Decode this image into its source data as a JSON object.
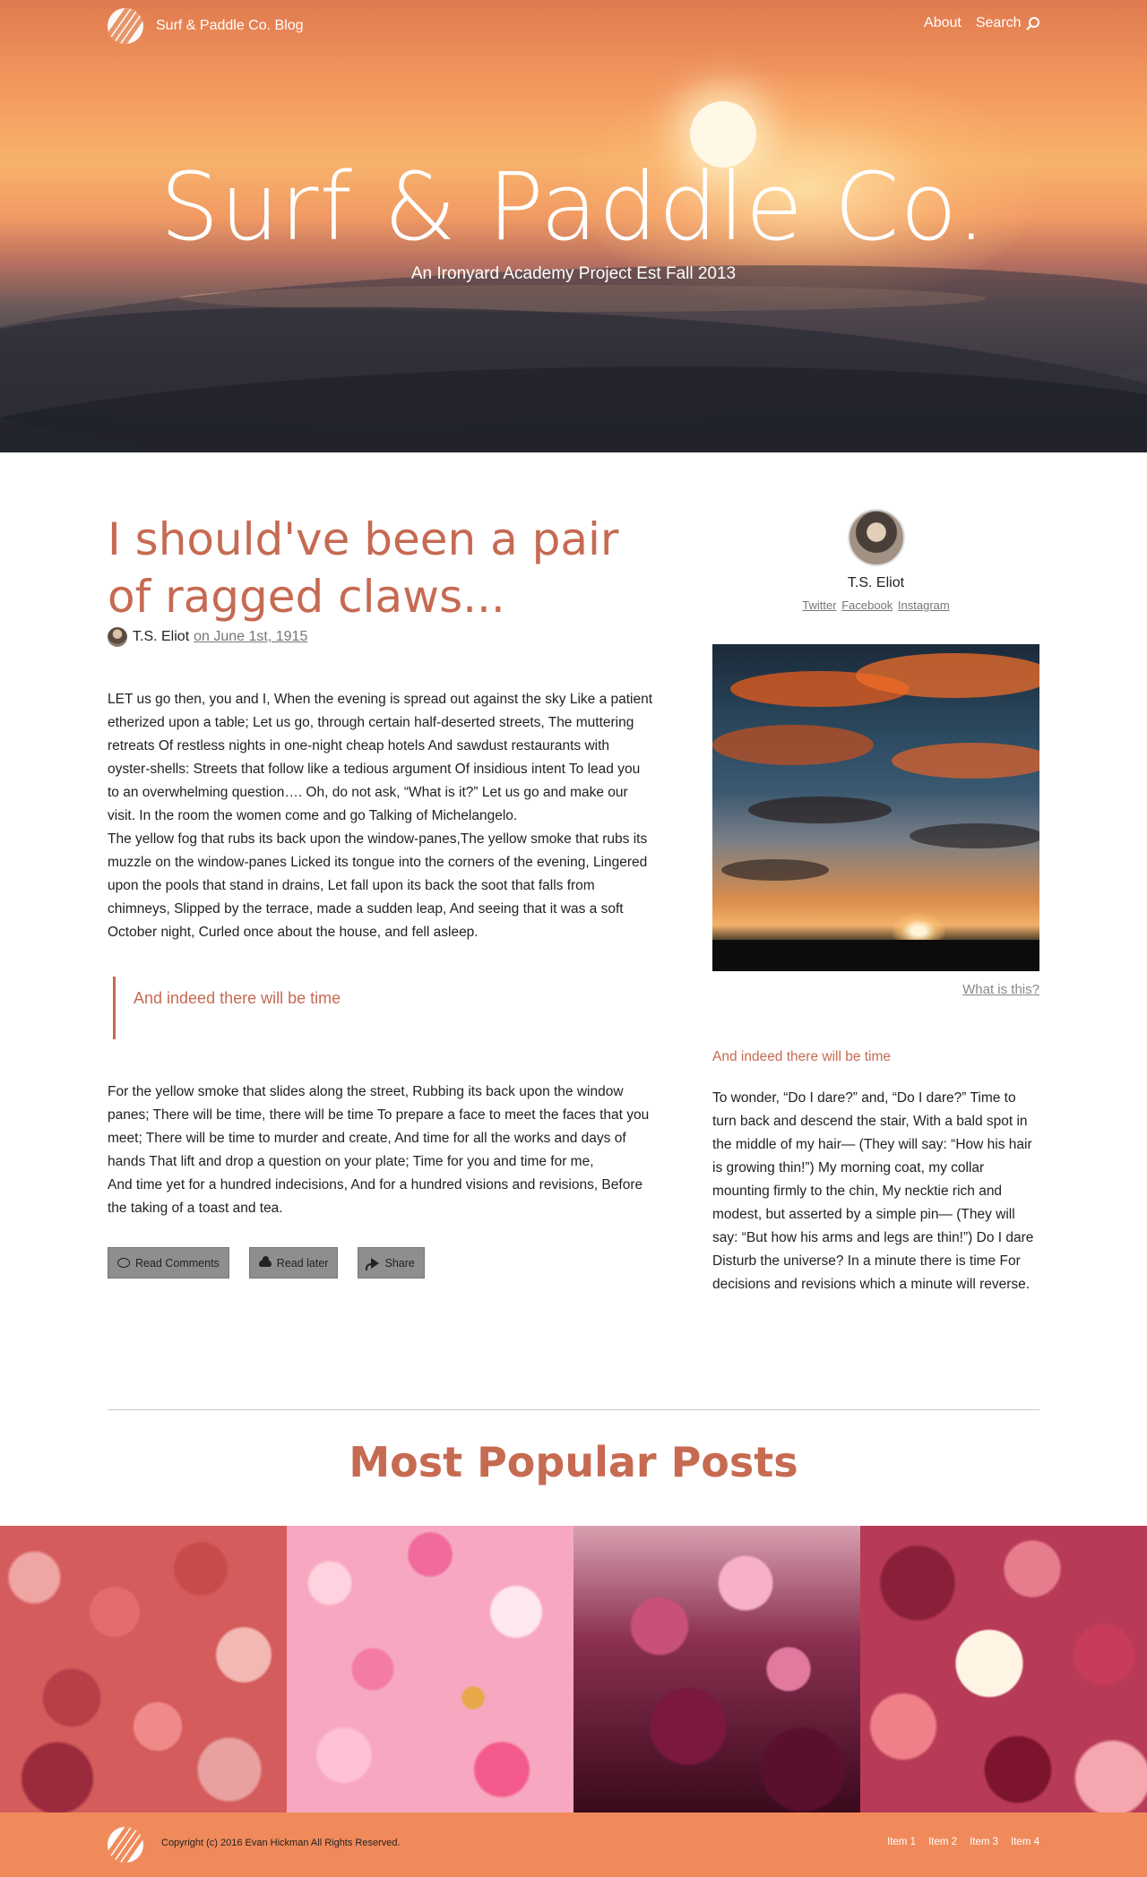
{
  "nav": {
    "brand": "Surf & Paddle Co. Blog",
    "links": [
      "About",
      "Search"
    ]
  },
  "hero": {
    "title": "Surf & Paddle Co.",
    "subtitle": "An Ironyard Academy Project Est Fall 2013"
  },
  "post": {
    "title": "I should've been a pair of ragged claws...",
    "author": "T.S. Eliot",
    "date": "on June 1st, 1915",
    "paragraph1": "LET us go then, you and I, When the evening is spread out against the sky Like a patient etherized upon a table; Let us go, through certain half-deserted streets, The muttering retreats Of restless nights in one-night cheap hotels And sawdust restaurants with oyster-shells: Streets that follow like a tedious argument Of insidious intent To lead you to an overwhelming question…. Oh, do not ask, “What is it?” Let us go and make our visit. In the room the women come and go Talking of Michelangelo.",
    "paragraph2": "The yellow fog that rubs its back upon the window-panes,The yellow smoke that rubs its muzzle on the window-panes Licked its tongue into the corners of the evening, Lingered upon the pools that stand in drains, Let fall upon its back the soot that falls from chimneys, Slipped by the terrace, made a sudden leap, And seeing that it was a soft October night, Curled once about the house, and fell asleep.",
    "quote": "And indeed there will be time",
    "paragraph3": "For the yellow smoke that slides along the street, Rubbing its back upon the window panes; There will be time, there will be time To prepare a face to meet the faces that you meet; There will be time to murder and create, And time for all the works and days of hands That lift and drop a question on your plate; Time for you and time for me,",
    "paragraph4": "And time yet for a hundred indecisions, And for a hundred visions and revisions, Before the taking of a toast and tea.",
    "actions": {
      "comments": "Read Comments",
      "later": "Read later",
      "share": "Share"
    }
  },
  "sidebar": {
    "name": "T.S. Eliot",
    "social": [
      "Twitter",
      "Facebook",
      "Instagram"
    ],
    "image_link": "What is this?",
    "heading": "And indeed there will be time",
    "text": "To wonder, “Do I dare?” and, “Do I dare?” Time to turn back and descend the stair, With a bald spot in the middle of my hair— (They will say: “How his hair is growing thin!”) My morning coat, my collar mounting firmly to the chin, My necktie rich and modest, but asserted by a simple pin— (They will say: “But how his arms and legs are thin!”) Do I dare Disturb the universe? In a minute there is time For decisions and revisions which a minute will reverse."
  },
  "popular": {
    "title": "Most Popular Posts"
  },
  "footer": {
    "copyright": "Copyright (c) 2016 Evan Hickman All Rights Reserved.",
    "items": [
      "Item 1",
      "Item 2",
      "Item 3",
      "Item 4"
    ]
  },
  "colors": {
    "accent": "#c66a52",
    "footer": "#f08a5a"
  }
}
